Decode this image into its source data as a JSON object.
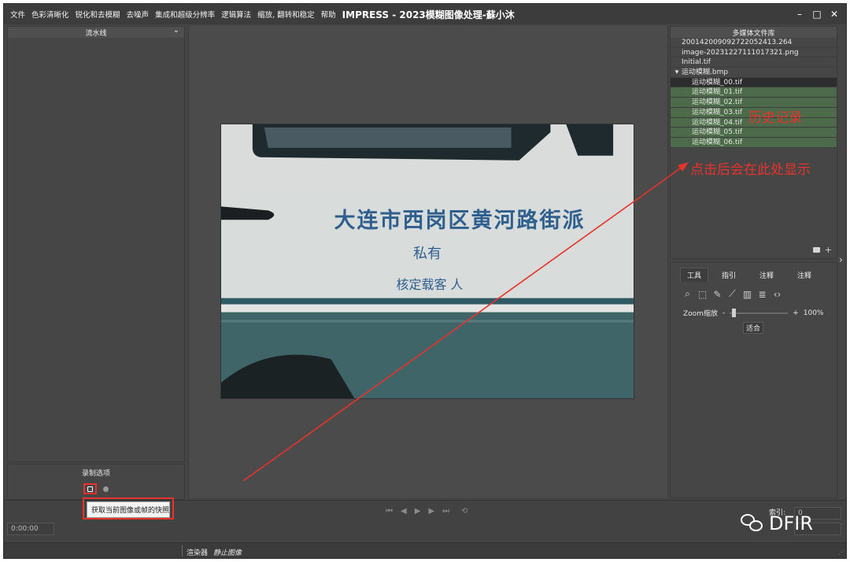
{
  "menu": [
    "文件",
    "色彩清晰化",
    "锐化和去模糊",
    "去噪声",
    "集成和超级分辨率",
    "逻辑算法",
    "缩放, 翻转和稳定",
    "帮助"
  ],
  "app_title": "IMPRESS - 2023模糊图像处理-蘇小沐",
  "window_controls": {
    "minimize": "–",
    "maximize": "□",
    "close": "✕"
  },
  "pipeline": {
    "title": "流水线",
    "chevron": "⌄"
  },
  "media_library": {
    "title": "多媒体文件库",
    "files": [
      "200142009092722052413.264",
      "image-20231227111017321.png",
      "Initial.tif"
    ],
    "folder": {
      "arrow": "▾",
      "name": "运动模糊.bmp"
    },
    "children": [
      "运动模糊_00.tif",
      "运动模糊_01.tif",
      "运动模糊_02.tif",
      "运动模糊_03.tif",
      "运动模糊_04.tif",
      "运动模糊_05.tif",
      "运动模糊_06.tif"
    ],
    "folder_icon": "folder-icon",
    "add": "+"
  },
  "tools": {
    "tabs": [
      "工具",
      "指引",
      "注释",
      "注释"
    ],
    "zoom_label": "Zoom缩放",
    "zoom_minus": "-",
    "zoom_plus": "+",
    "zoom_value": "100%",
    "zoom_level": 0.05,
    "fit_button": "适合"
  },
  "recording": {
    "title": "录制选项",
    "tooltip": "获取当前图像或帧的快照"
  },
  "playback": {
    "time": "0:00:00",
    "index_label": "索引:",
    "index_value": "0"
  },
  "status": {
    "renderer": "渲染器",
    "state": "静止图像"
  },
  "photo": {
    "line1": "大连市西岗区黄河路街派",
    "line2": "私有",
    "line3": "核定载客 人"
  },
  "annotations": {
    "history": "历史记录",
    "click_show": "点击后会在此处显示"
  },
  "watermark": {
    "text": "DFIR",
    "icon": "wechat-icon"
  },
  "colors": {
    "accent_red": "#e8322b",
    "history_green": "#4d6a4a"
  }
}
